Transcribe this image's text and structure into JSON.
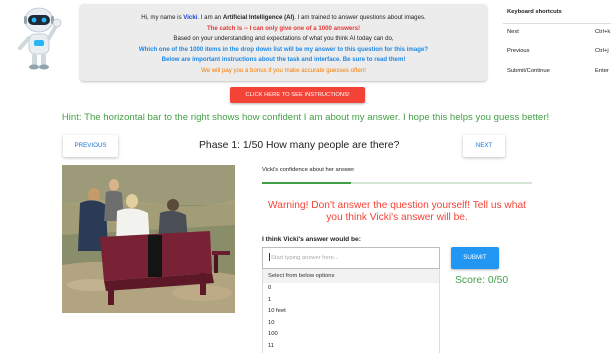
{
  "intro": {
    "line1_pre": "Hi, my name is ",
    "name": "Vicki",
    "line1_mid": ". I am an ",
    "ai_label": "Artificial Intelligence (AI)",
    "line1_post": ". I am trained to answer questions about images.",
    "line2": "The catch is -- I can only give one of a 1000 answers!",
    "line3": "Based on your understanding and expectations of what you think AI today can do,",
    "line4": "Which one of the 1000 items in the drop down list will be my answer to this question for this image?",
    "line5": "Below are important instructions about the task and interface. Be sure to read them!",
    "line6": "We will pay you a bonus if you make accurate guesses often!"
  },
  "shortcuts": {
    "title": "Keyboard shortcuts",
    "rows": [
      {
        "action": "Next",
        "key": "Ctrl+k"
      },
      {
        "action": "Previous",
        "key": "Ctrl+j"
      },
      {
        "action": "Submit/Continue",
        "key": "Enter"
      }
    ]
  },
  "instructions_button": "CLICK HERE TO SEE INSTRUCTIONS!",
  "hint": "Hint: The horizontal bar to the right shows how confident I am about my answer. I hope this helps you guess better!",
  "nav": {
    "previous": "PREVIOUS",
    "next": "NEXT",
    "phase_title": "Phase 1: 1/50 How many people are there?"
  },
  "confidence": {
    "label": "Vicki's confidence about her answer",
    "value": 0.33
  },
  "warning": "Warning! Don't answer the question yourself! Tell us what you think Vicki's answer will be.",
  "answer": {
    "label": "I think Vicki's answer would be:",
    "placeholder": "Start typing answer here...",
    "dropdown_header": "Select from below options",
    "options": [
      "0",
      "1",
      "10 feet",
      "10",
      "100",
      "11"
    ]
  },
  "submit": "SUBMIT",
  "score": "Score: 0/50",
  "colors": {
    "green": "#43a047",
    "red": "#f44336",
    "blue": "#2196f3"
  }
}
